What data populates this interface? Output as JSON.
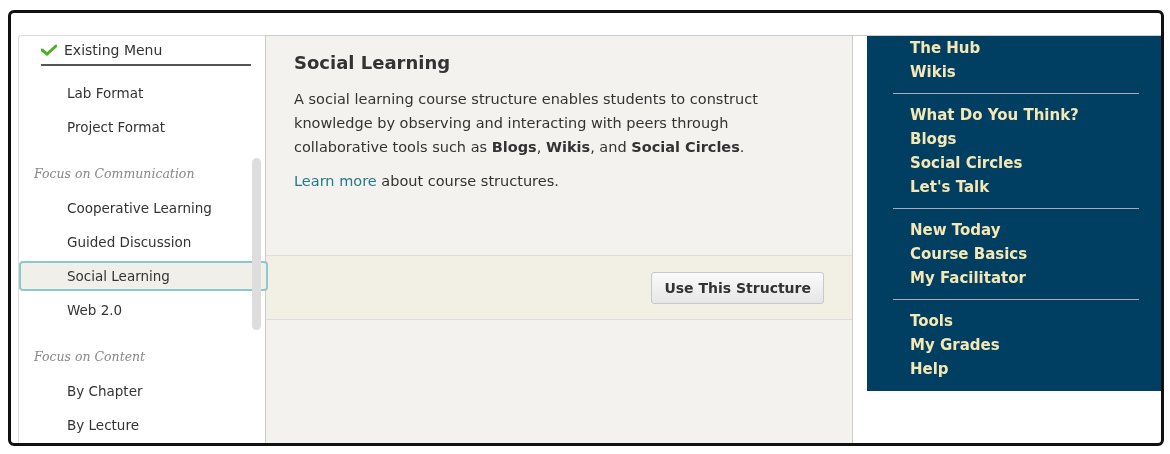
{
  "sidebar": {
    "current": {
      "label": "Existing Menu",
      "checked": true
    },
    "groups": [
      {
        "items": [
          {
            "label": "Lab Format",
            "selected": false
          },
          {
            "label": "Project Format",
            "selected": false
          }
        ]
      },
      {
        "heading": "Focus on Communication",
        "items": [
          {
            "label": "Cooperative Learning",
            "selected": false
          },
          {
            "label": "Guided Discussion",
            "selected": false
          },
          {
            "label": "Social Learning",
            "selected": true
          },
          {
            "label": "Web 2.0",
            "selected": false
          }
        ]
      },
      {
        "heading": "Focus on Content",
        "items": [
          {
            "label": "By Chapter",
            "selected": false
          },
          {
            "label": "By Lecture",
            "selected": false
          }
        ]
      }
    ]
  },
  "detail": {
    "title": "Social Learning",
    "description": "A social learning course structure enables students to construct knowledge by observing and interacting with peers through collaborative tools such as **Blogs**, **Wikis**, and **Social Circles**.",
    "learn_more_link": "Learn more",
    "learn_more_text": "about course structures.",
    "button": "Use This Structure"
  },
  "preview_menu": {
    "sections": [
      [
        "The Hub",
        "Wikis"
      ],
      [
        "What Do You Think?",
        "Blogs",
        "Social Circles",
        "Let's Talk"
      ],
      [
        "New Today",
        "Course Basics",
        "My Facilitator"
      ],
      [
        "Tools",
        "My Grades",
        "Help"
      ]
    ]
  }
}
